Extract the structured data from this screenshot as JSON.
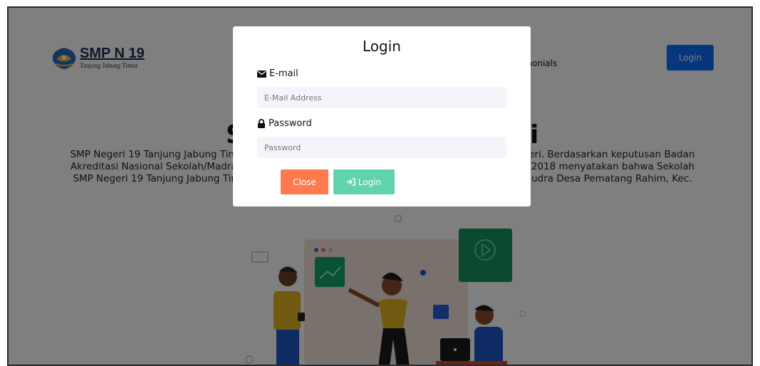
{
  "brand": {
    "title": "SMP N 19",
    "subtitle": "Tanjung Jabung Timur"
  },
  "nav": {
    "testimonials_label": "Testimonials",
    "login_label": "Login"
  },
  "hero": {
    "title_left": "S",
    "title_right": "i",
    "paragraph": "SMP Negeri 19 Tanjung Jabung Timur ... eri. Berdasarkan keputusan Badan Akreditasi Nasional Sekolah/Madrasah ... /2018 menyatakan bahwa Sekolah SMP Negeri 19 Tanjung Jabung Timur ... udra Desa Pematang Rahim, Kec."
  },
  "hero_visible": {
    "line1_left": "SMP Negeri 19 Tanjung Jabung Tim",
    "line1_right": "eri. Berdasarkan keputusan Badan",
    "line2_left": "Akreditasi Nasional Sekolah/Madra",
    "line2_right": "/2018 menyatakan bahwa Sekolah",
    "line3_left": "SMP Negeri 19 Tanjung Jabung Tim",
    "line3_right": "udra Desa Pematang Rahim, Kec."
  },
  "nav_visible": {
    "testimonials_fragment": "imonials"
  },
  "modal": {
    "title": "Login",
    "email_label": "E-mail",
    "email_placeholder": "E-Mail Address",
    "email_value": "",
    "password_label": "Password",
    "password_placeholder": "Password",
    "password_value": "",
    "close_label": "Close",
    "login_label": "Login"
  },
  "colors": {
    "primary": "#0d6efd",
    "close": "#ff7a4d",
    "login": "#5fd3ac",
    "overlay": "rgba(0,0,0,0.5)"
  },
  "icons": {
    "email": "envelope-icon",
    "password": "lock-icon",
    "login": "sign-in-icon"
  }
}
